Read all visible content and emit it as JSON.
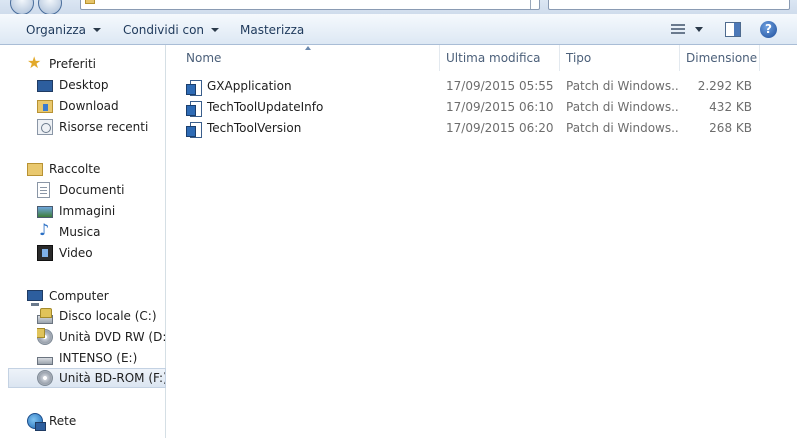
{
  "toolbar": {
    "organize": "Organizza",
    "share": "Condividi con",
    "burn": "Masterizza",
    "help": "?"
  },
  "nav": {
    "favorites": "Preferiti",
    "desktop": "Desktop",
    "download": "Download",
    "recent": "Risorse recenti",
    "libraries": "Raccolte",
    "documents": "Documenti",
    "images": "Immagini",
    "music": "Musica",
    "video": "Video",
    "computer": "Computer",
    "local_disk": "Disco locale (C:)",
    "dvd": "Unità DVD RW (D:) C",
    "usb": "INTENSO (E:)",
    "bd": "Unità BD-ROM (F:) F",
    "network": "Rete"
  },
  "columns": {
    "name": "Nome",
    "date": "Ultima modifica",
    "type": "Tipo",
    "size": "Dimensione"
  },
  "files": [
    {
      "name": "GXApplication",
      "date": "17/09/2015 05:55",
      "type": "Patch di Windows...",
      "size": "2.292 KB"
    },
    {
      "name": "TechToolUpdateInfo",
      "date": "17/09/2015 06:10",
      "type": "Patch di Windows...",
      "size": "432 KB"
    },
    {
      "name": "TechToolVersion",
      "date": "17/09/2015 06:20",
      "type": "Patch di Windows...",
      "size": "268 KB"
    }
  ]
}
